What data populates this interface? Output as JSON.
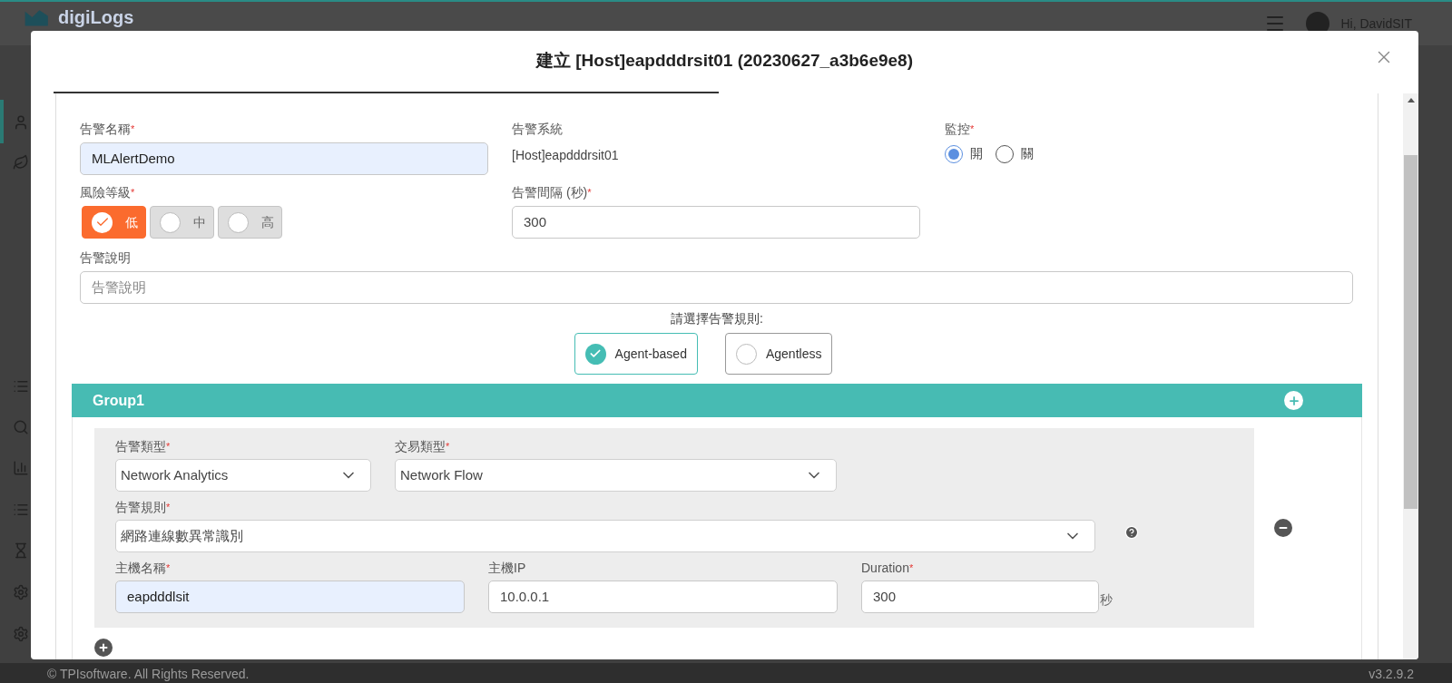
{
  "app": {
    "logo": "digiLogs",
    "greeting": "Hi, DavidSIT",
    "footer": "© TPIsoftware. All Rights Reserved.",
    "version": "v3.2.9.2"
  },
  "dialog": {
    "title": "建立 [Host]eapdddrsit01 (20230627_a3b6e9e8)",
    "alert_name": {
      "label": "告警名稱",
      "mark": "*",
      "value": "MLAlertDemo"
    },
    "alert_system": {
      "label": "告警系統",
      "value": "[Host]eapdddrsit01"
    },
    "monitoring": {
      "label": "監控",
      "mark": "*",
      "options": [
        {
          "label": "開",
          "selected": true
        },
        {
          "label": "關",
          "selected": false
        }
      ]
    },
    "risk_level": {
      "label": "風險等級",
      "mark": "*",
      "options": [
        {
          "label": "低",
          "selected": true
        },
        {
          "label": "中",
          "selected": false
        },
        {
          "label": "高",
          "selected": false
        }
      ]
    },
    "interval": {
      "label": "告警間隔 (秒)",
      "mark": "*",
      "value": "300"
    },
    "description": {
      "label": "告警說明",
      "placeholder": "告警說明"
    },
    "rule_prompt": "請選擇告警規則:",
    "rule_types": [
      {
        "label": "Agent-based",
        "selected": true
      },
      {
        "label": "Agentless",
        "selected": false
      }
    ],
    "group": {
      "title": "Group1",
      "alert_type": {
        "label": "告警類型",
        "mark": "*",
        "value": "Network Analytics"
      },
      "transaction_type": {
        "label": "交易類型",
        "mark": "*",
        "value": "Network Flow"
      },
      "alert_rule": {
        "label": "告警規則",
        "mark": "*",
        "value": "網路連線數異常識別"
      },
      "host_name": {
        "label": "主機名稱",
        "mark": "*",
        "value": "eapdddlsit"
      },
      "host_ip": {
        "label": "主機IP",
        "value": "10.0.0.1"
      },
      "duration": {
        "label": "Duration",
        "mark": "*",
        "value": "300",
        "unit": "秒"
      }
    }
  }
}
